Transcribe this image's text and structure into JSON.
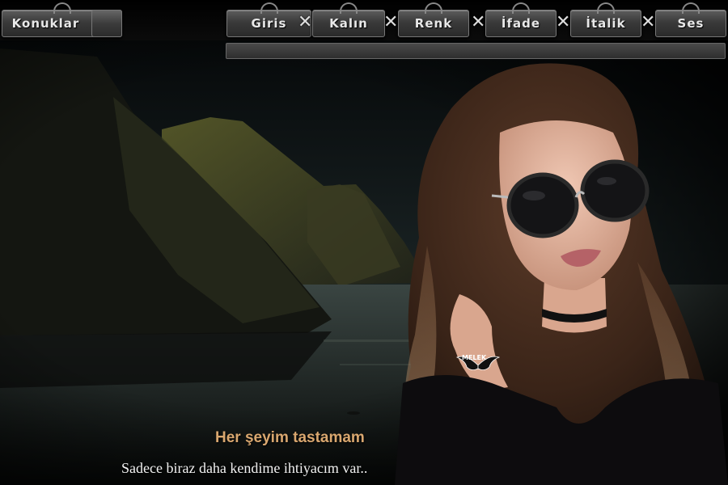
{
  "topbar": {
    "guests_label": "Konuklar",
    "buttons": [
      {
        "label": "Giris"
      },
      {
        "label": "Kalın"
      },
      {
        "label": "Renk"
      },
      {
        "label": "İfade"
      },
      {
        "label": "İtalik"
      },
      {
        "label": "Ses"
      }
    ],
    "separator": "✕"
  },
  "captions": {
    "line1": "Her şeyim tastamam",
    "line2": "Sadece biraz daha kendime ihtiyacım var.."
  },
  "watermark": {
    "text": "MELEK"
  },
  "colors": {
    "caption_accent": "#d9a76f",
    "button_face": "#3a3a3a"
  }
}
